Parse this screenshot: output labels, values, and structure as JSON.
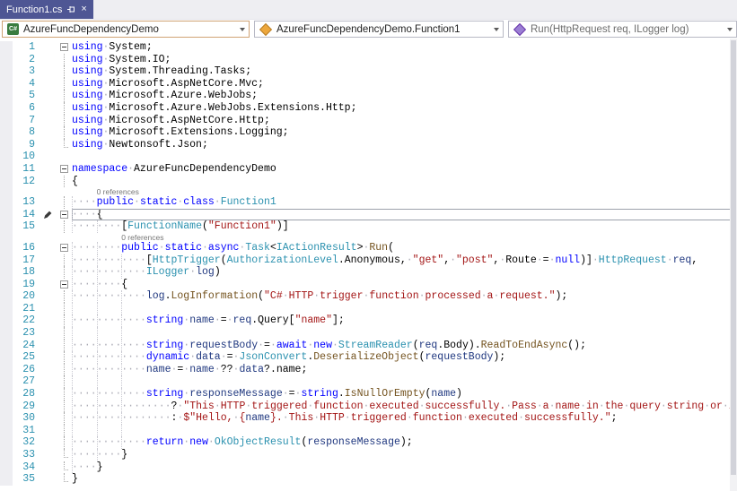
{
  "tab": {
    "title": "Function1.cs",
    "close_glyph": "×"
  },
  "navbar": {
    "project_icon_text": "C#",
    "project": "AzureFuncDependencyDemo",
    "type": "AzureFuncDependencyDemo.Function1",
    "member": "Run(HttpRequest req, ILogger log)"
  },
  "colors": {
    "keyword": "#0000FF",
    "type": "#2B91AF",
    "string": "#A31515",
    "method": "#74531F",
    "variable": "#1F377F",
    "plain": "#000000",
    "lineNumber": "#2B91AF",
    "whitespace": "#ABABB5",
    "guide": "#C9C9D1",
    "lens": "#767676",
    "editorBg": "#FFFFFF",
    "tabActive": "#4E5694",
    "tabText": "#FFFFFF",
    "tabStrip": "#EEEEF2",
    "comboBorder": "#B8B9C5",
    "comboFocusBorder": "#D0A375",
    "memberText": "#6D6D6D",
    "classIcon": "#EDA73C",
    "methodIcon": "#9B7FD4",
    "projectIconBg": "#3A7C3F"
  },
  "editor": {
    "codelens_label": "0 references",
    "lines": [
      {
        "n": 1,
        "fold": "box",
        "g": [],
        "segs": [
          [
            "k",
            "using"
          ],
          [
            "p",
            " System;"
          ]
        ]
      },
      {
        "n": 2,
        "fold": "line",
        "g": [],
        "segs": [
          [
            "k",
            "using"
          ],
          [
            "p",
            " System.IO;"
          ]
        ]
      },
      {
        "n": 3,
        "fold": "line",
        "g": [],
        "segs": [
          [
            "k",
            "using"
          ],
          [
            "p",
            " System.Threading.Tasks;"
          ]
        ]
      },
      {
        "n": 4,
        "fold": "line",
        "g": [],
        "segs": [
          [
            "k",
            "using"
          ],
          [
            "p",
            " Microsoft.AspNetCore.Mvc;"
          ]
        ]
      },
      {
        "n": 5,
        "fold": "line",
        "g": [],
        "segs": [
          [
            "k",
            "using"
          ],
          [
            "p",
            " Microsoft.Azure.WebJobs;"
          ]
        ]
      },
      {
        "n": 6,
        "fold": "line",
        "g": [],
        "segs": [
          [
            "k",
            "using"
          ],
          [
            "p",
            " Microsoft.Azure.WebJobs.Extensions.Http;"
          ]
        ]
      },
      {
        "n": 7,
        "fold": "line",
        "g": [],
        "segs": [
          [
            "k",
            "using"
          ],
          [
            "p",
            " Microsoft.AspNetCore.Http;"
          ]
        ]
      },
      {
        "n": 8,
        "fold": "line",
        "g": [],
        "segs": [
          [
            "k",
            "using"
          ],
          [
            "p",
            " Microsoft.Extensions.Logging;"
          ]
        ]
      },
      {
        "n": 9,
        "fold": "end",
        "g": [],
        "segs": [
          [
            "k",
            "using"
          ],
          [
            "p",
            " Newtonsoft.Json;"
          ]
        ]
      },
      {
        "n": 10,
        "fold": "",
        "g": [],
        "segs": []
      },
      {
        "n": 11,
        "fold": "box",
        "g": [],
        "segs": [
          [
            "k",
            "namespace"
          ],
          [
            "p",
            " AzureFuncDependencyDemo"
          ]
        ]
      },
      {
        "n": 12,
        "fold": "line",
        "g": [],
        "segs": [
          [
            "p",
            "{"
          ]
        ]
      },
      {
        "n": 13,
        "fold": "line",
        "g": [
          0
        ],
        "lens": "0 references",
        "lensIndent": 4,
        "segs": [
          [
            "p",
            "    "
          ],
          [
            "k",
            "public static class"
          ],
          [
            "p",
            " "
          ],
          [
            "t",
            "Function1"
          ]
        ]
      },
      {
        "n": 14,
        "fold": "box",
        "active": true,
        "marker": true,
        "g": [
          0
        ],
        "segs": [
          [
            "p",
            "    {"
          ]
        ]
      },
      {
        "n": 15,
        "fold": "line",
        "g": [
          0,
          4
        ],
        "segs": [
          [
            "p",
            "        ["
          ],
          [
            "t",
            "FunctionName"
          ],
          [
            "p",
            "("
          ],
          [
            "s",
            "\"Function1\""
          ],
          [
            "p",
            ")]"
          ]
        ]
      },
      {
        "n": 16,
        "fold": "box",
        "g": [
          0,
          4
        ],
        "lens": "0 references",
        "lensIndent": 8,
        "segs": [
          [
            "p",
            "        "
          ],
          [
            "k",
            "public static async"
          ],
          [
            "p",
            " "
          ],
          [
            "t",
            "Task"
          ],
          [
            "p",
            "<"
          ],
          [
            "t",
            "IActionResult"
          ],
          [
            "p",
            "> "
          ],
          [
            "m",
            "Run"
          ],
          [
            "p",
            "("
          ]
        ]
      },
      {
        "n": 17,
        "fold": "line",
        "g": [
          0,
          4,
          8
        ],
        "segs": [
          [
            "p",
            "            ["
          ],
          [
            "t",
            "HttpTrigger"
          ],
          [
            "p",
            "("
          ],
          [
            "t",
            "AuthorizationLevel"
          ],
          [
            "p",
            ".Anonymous, "
          ],
          [
            "s",
            "\"get\""
          ],
          [
            "p",
            ", "
          ],
          [
            "s",
            "\"post\""
          ],
          [
            "p",
            ", Route = "
          ],
          [
            "k",
            "null"
          ],
          [
            "p",
            ")] "
          ],
          [
            "t",
            "HttpRequest"
          ],
          [
            "p",
            " "
          ],
          [
            "v",
            "req"
          ],
          [
            "p",
            ","
          ]
        ]
      },
      {
        "n": 18,
        "fold": "line",
        "g": [
          0,
          4,
          8
        ],
        "segs": [
          [
            "p",
            "            "
          ],
          [
            "t",
            "ILogger"
          ],
          [
            "p",
            " "
          ],
          [
            "v",
            "log"
          ],
          [
            "p",
            ")"
          ]
        ]
      },
      {
        "n": 19,
        "fold": "box",
        "g": [
          0,
          4
        ],
        "segs": [
          [
            "p",
            "        {"
          ]
        ]
      },
      {
        "n": 20,
        "fold": "line",
        "g": [
          0,
          4,
          8
        ],
        "segs": [
          [
            "p",
            "            "
          ],
          [
            "v",
            "log"
          ],
          [
            "p",
            "."
          ],
          [
            "m",
            "LogInformation"
          ],
          [
            "p",
            "("
          ],
          [
            "s",
            "\"C# HTTP trigger function processed a request.\""
          ],
          [
            "p",
            ");"
          ]
        ]
      },
      {
        "n": 21,
        "fold": "line",
        "g": [
          0,
          4,
          8
        ],
        "segs": []
      },
      {
        "n": 22,
        "fold": "line",
        "g": [
          0,
          4,
          8
        ],
        "segs": [
          [
            "p",
            "            "
          ],
          [
            "k",
            "string"
          ],
          [
            "p",
            " "
          ],
          [
            "v",
            "name"
          ],
          [
            "p",
            " = "
          ],
          [
            "v",
            "req"
          ],
          [
            "p",
            ".Query["
          ],
          [
            "s",
            "\"name\""
          ],
          [
            "p",
            "];"
          ]
        ]
      },
      {
        "n": 23,
        "fold": "line",
        "g": [
          0,
          4,
          8
        ],
        "segs": []
      },
      {
        "n": 24,
        "fold": "line",
        "g": [
          0,
          4,
          8
        ],
        "segs": [
          [
            "p",
            "            "
          ],
          [
            "k",
            "string"
          ],
          [
            "p",
            " "
          ],
          [
            "v",
            "requestBody"
          ],
          [
            "p",
            " = "
          ],
          [
            "k",
            "await"
          ],
          [
            "p",
            " "
          ],
          [
            "k",
            "new"
          ],
          [
            "p",
            " "
          ],
          [
            "t",
            "StreamReader"
          ],
          [
            "p",
            "("
          ],
          [
            "v",
            "req"
          ],
          [
            "p",
            ".Body)."
          ],
          [
            "m",
            "ReadToEndAsync"
          ],
          [
            "p",
            "();"
          ]
        ]
      },
      {
        "n": 25,
        "fold": "line",
        "g": [
          0,
          4,
          8
        ],
        "segs": [
          [
            "p",
            "            "
          ],
          [
            "k",
            "dynamic"
          ],
          [
            "p",
            " "
          ],
          [
            "v",
            "data"
          ],
          [
            "p",
            " = "
          ],
          [
            "t",
            "JsonConvert"
          ],
          [
            "p",
            "."
          ],
          [
            "m",
            "DeserializeObject"
          ],
          [
            "p",
            "("
          ],
          [
            "v",
            "requestBody"
          ],
          [
            "p",
            ");"
          ]
        ]
      },
      {
        "n": 26,
        "fold": "line",
        "g": [
          0,
          4,
          8
        ],
        "segs": [
          [
            "p",
            "            "
          ],
          [
            "v",
            "name"
          ],
          [
            "p",
            " = "
          ],
          [
            "v",
            "name"
          ],
          [
            "p",
            " ?? "
          ],
          [
            "v",
            "data"
          ],
          [
            "p",
            "?.name;"
          ]
        ]
      },
      {
        "n": 27,
        "fold": "line",
        "g": [
          0,
          4,
          8
        ],
        "segs": []
      },
      {
        "n": 28,
        "fold": "line",
        "g": [
          0,
          4,
          8
        ],
        "segs": [
          [
            "p",
            "            "
          ],
          [
            "k",
            "string"
          ],
          [
            "p",
            " "
          ],
          [
            "v",
            "responseMessage"
          ],
          [
            "p",
            " = "
          ],
          [
            "k",
            "string"
          ],
          [
            "p",
            "."
          ],
          [
            "m",
            "IsNullOrEmpty"
          ],
          [
            "p",
            "("
          ],
          [
            "v",
            "name"
          ],
          [
            "p",
            ")"
          ]
        ]
      },
      {
        "n": 29,
        "fold": "line",
        "g": [
          0,
          4,
          8
        ],
        "segs": [
          [
            "p",
            "                ? "
          ],
          [
            "s",
            "\"This HTTP triggered function executed successfully. Pass a name in the query string or in the request body \""
          ]
        ]
      },
      {
        "n": 30,
        "fold": "line",
        "g": [
          0,
          4,
          8
        ],
        "segs": [
          [
            "p",
            "                : "
          ],
          [
            "s",
            "$\"Hello, {"
          ],
          [
            "v",
            "name"
          ],
          [
            "s",
            "}. This HTTP triggered function executed successfully.\""
          ],
          [
            "p",
            ";"
          ]
        ]
      },
      {
        "n": 31,
        "fold": "line",
        "g": [
          0,
          4,
          8
        ],
        "segs": []
      },
      {
        "n": 32,
        "fold": "line",
        "g": [
          0,
          4,
          8
        ],
        "segs": [
          [
            "p",
            "            "
          ],
          [
            "k",
            "return"
          ],
          [
            "p",
            " "
          ],
          [
            "k",
            "new"
          ],
          [
            "p",
            " "
          ],
          [
            "t",
            "OkObjectResult"
          ],
          [
            "p",
            "("
          ],
          [
            "v",
            "responseMessage"
          ],
          [
            "p",
            ");"
          ]
        ]
      },
      {
        "n": 33,
        "fold": "end",
        "g": [
          0,
          4
        ],
        "segs": [
          [
            "p",
            "        }"
          ]
        ]
      },
      {
        "n": 34,
        "fold": "end",
        "g": [
          0
        ],
        "segs": [
          [
            "p",
            "    }"
          ]
        ]
      },
      {
        "n": 35,
        "fold": "end",
        "g": [],
        "segs": [
          [
            "p",
            "}"
          ]
        ]
      }
    ]
  }
}
